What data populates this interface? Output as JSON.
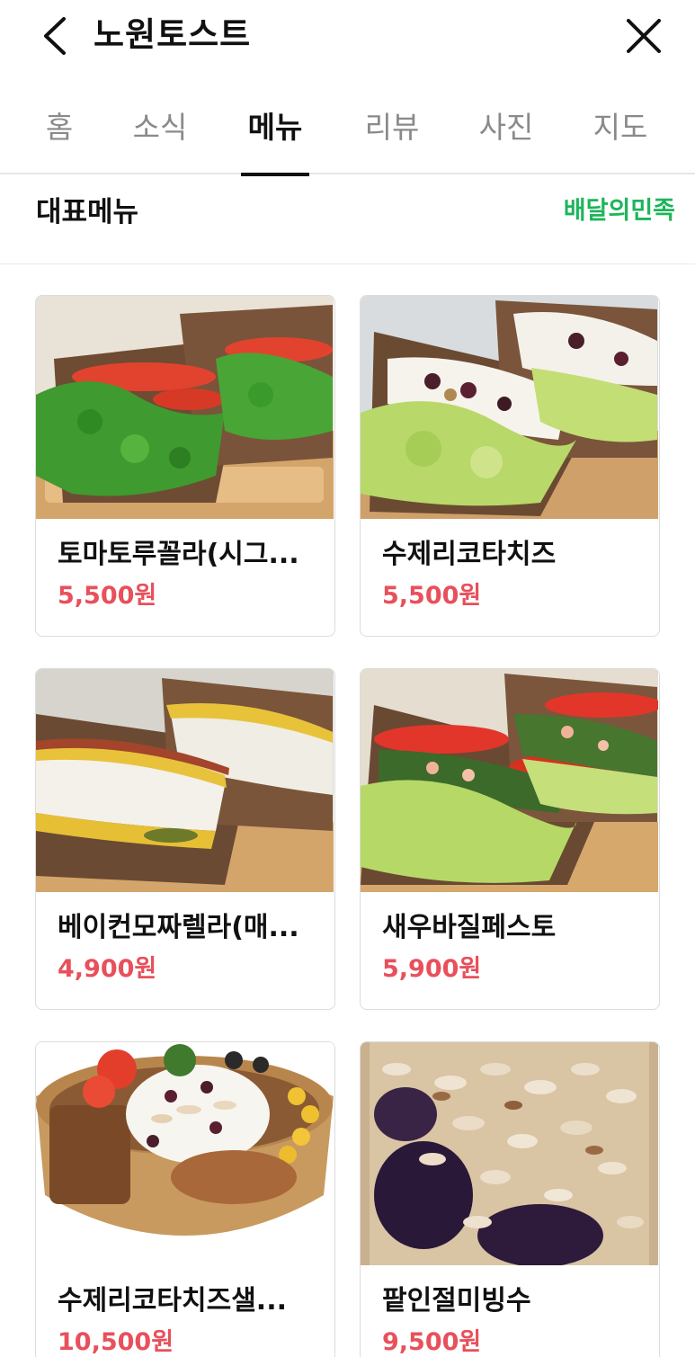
{
  "header": {
    "title": "노원토스트"
  },
  "tabs": [
    {
      "label": "홈",
      "active": false
    },
    {
      "label": "소식",
      "active": false
    },
    {
      "label": "메뉴",
      "active": true
    },
    {
      "label": "리뷰",
      "active": false
    },
    {
      "label": "사진",
      "active": false
    },
    {
      "label": "지도",
      "active": false
    }
  ],
  "section": {
    "title": "대표메뉴",
    "link": "배달의민족"
  },
  "menu_items": [
    {
      "name": "토마토루꼴라(시그...",
      "price": "5,500원",
      "photo": "tomato-arugula-sandwich"
    },
    {
      "name": "수제리코타치즈",
      "price": "5,500원",
      "photo": "ricotta-sandwich"
    },
    {
      "name": "베이컨모짜렐라(매...",
      "price": "4,900원",
      "photo": "bacon-mozzarella-sandwich"
    },
    {
      "name": "새우바질페스토",
      "price": "5,900원",
      "photo": "shrimp-pesto-sandwich"
    },
    {
      "name": "수제리코타치즈샐...",
      "price": "10,500원",
      "photo": "ricotta-salad-bowl"
    },
    {
      "name": "팥인절미빙수",
      "price": "9,500원",
      "photo": "red-bean-bingsu"
    }
  ],
  "colors": {
    "accent_green": "#1db55a",
    "price_red": "#e8505b",
    "active_tab": "#111111",
    "inactive_tab": "#8a8a8a"
  }
}
